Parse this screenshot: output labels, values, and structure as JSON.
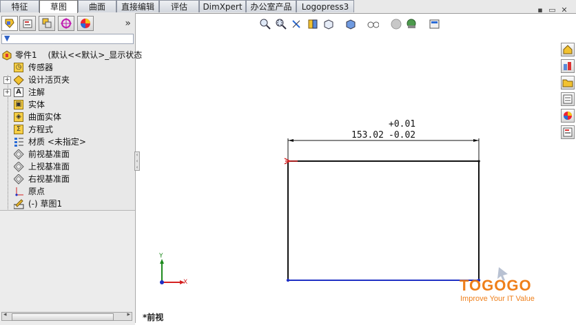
{
  "tabs": [
    "特征",
    "草图",
    "曲面",
    "直接编辑",
    "评估",
    "DimXpert",
    "办公室产品",
    "Logopress3"
  ],
  "active_tab": "草图",
  "window_buttons": {
    "pin": "▪",
    "restore": "▭",
    "close": "✕"
  },
  "panel": {
    "expand_label": "»",
    "filter_glyph": "▼",
    "tree": [
      {
        "label": "零件1 　(默认<<默认>_显示状态",
        "icon": "part-icon"
      },
      {
        "label": "传感器",
        "icon": "sensor-icon"
      },
      {
        "label": "设计活页夹",
        "icon": "design-binder-icon",
        "expander": "+"
      },
      {
        "label": "注解",
        "icon": "annotations-icon",
        "expander": "+",
        "icon_glyph": "A"
      },
      {
        "label": "实体",
        "icon": "solid-bodies-icon"
      },
      {
        "label": "曲面实体",
        "icon": "surface-bodies-icon"
      },
      {
        "label": "方程式",
        "icon": "equations-icon",
        "icon_glyph": "Σ"
      },
      {
        "label": "材质 <未指定>",
        "icon": "material-icon"
      },
      {
        "label": "前视基准面",
        "icon": "plane-icon"
      },
      {
        "label": "上视基准面",
        "icon": "plane-icon"
      },
      {
        "label": "右视基准面",
        "icon": "plane-icon"
      },
      {
        "label": "原点",
        "icon": "origin-icon"
      },
      {
        "label": "(-) 草图1",
        "icon": "sketch-icon"
      }
    ]
  },
  "sketch": {
    "dimension_value": "153.02",
    "tolerance_upper": "+0.01",
    "tolerance_lower": "-0.02"
  },
  "triad": {
    "x_label": "X",
    "y_label": "Y"
  },
  "view_label": "*前视",
  "watermark": {
    "brand": "TOGOGO",
    "tagline": "Improve Your IT Value"
  },
  "colors": {
    "accent_orange": "#ef7f1a",
    "sketch_blue": "#1e2fc4",
    "sketch_red": "#d42020"
  }
}
